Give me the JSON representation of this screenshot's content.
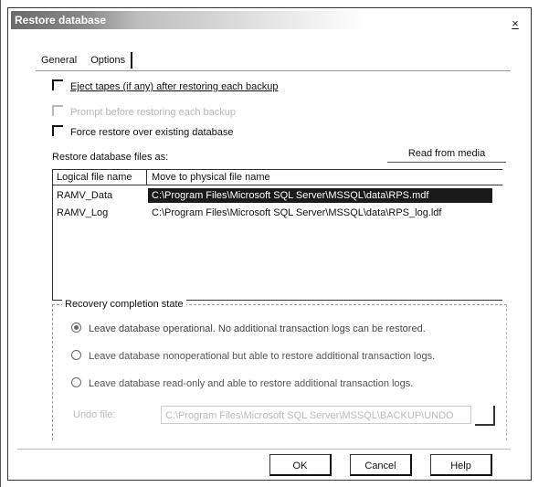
{
  "window": {
    "title": "Restore database",
    "close_label": "×"
  },
  "tabs": [
    {
      "label": "General"
    },
    {
      "label": "Options"
    }
  ],
  "options": [
    {
      "label": "Eject tapes (if any) after restoring each backup",
      "checked": false,
      "enabled": true
    },
    {
      "label": "Prompt before restoring each backup",
      "checked": false,
      "enabled": false
    },
    {
      "label": "Force restore over existing database",
      "checked": false,
      "enabled": true
    }
  ],
  "files_section": {
    "label": "Restore database files as:",
    "read_media_label": "Read from media",
    "columns": [
      "Logical file name",
      "Move to physical file name"
    ],
    "rows": [
      {
        "logical": "RAMV_Data",
        "physical": "C:\\Program Files\\Microsoft SQL Server\\MSSQL\\data\\RPS.mdf",
        "selected": true
      },
      {
        "logical": "RAMV_Log",
        "physical": "C:\\Program Files\\Microsoft SQL Server\\MSSQL\\data\\RPS_log.ldf",
        "selected": false
      }
    ]
  },
  "recovery": {
    "title": "Recovery completion state",
    "options": [
      {
        "label": "Leave database operational. No additional transaction logs can be restored.",
        "selected": true
      },
      {
        "label": "Leave database nonoperational but able to restore additional transaction logs.",
        "selected": false
      },
      {
        "label": "Leave database read-only and able to restore additional transaction logs.",
        "selected": false
      }
    ],
    "undo_file_label": "Undo file:",
    "undo_file_value": "C:\\Program Files\\Microsoft SQL Server\\MSSQL\\BACKUP\\UNDO"
  },
  "buttons": {
    "ok": "OK",
    "cancel": "Cancel",
    "help": "Help"
  }
}
